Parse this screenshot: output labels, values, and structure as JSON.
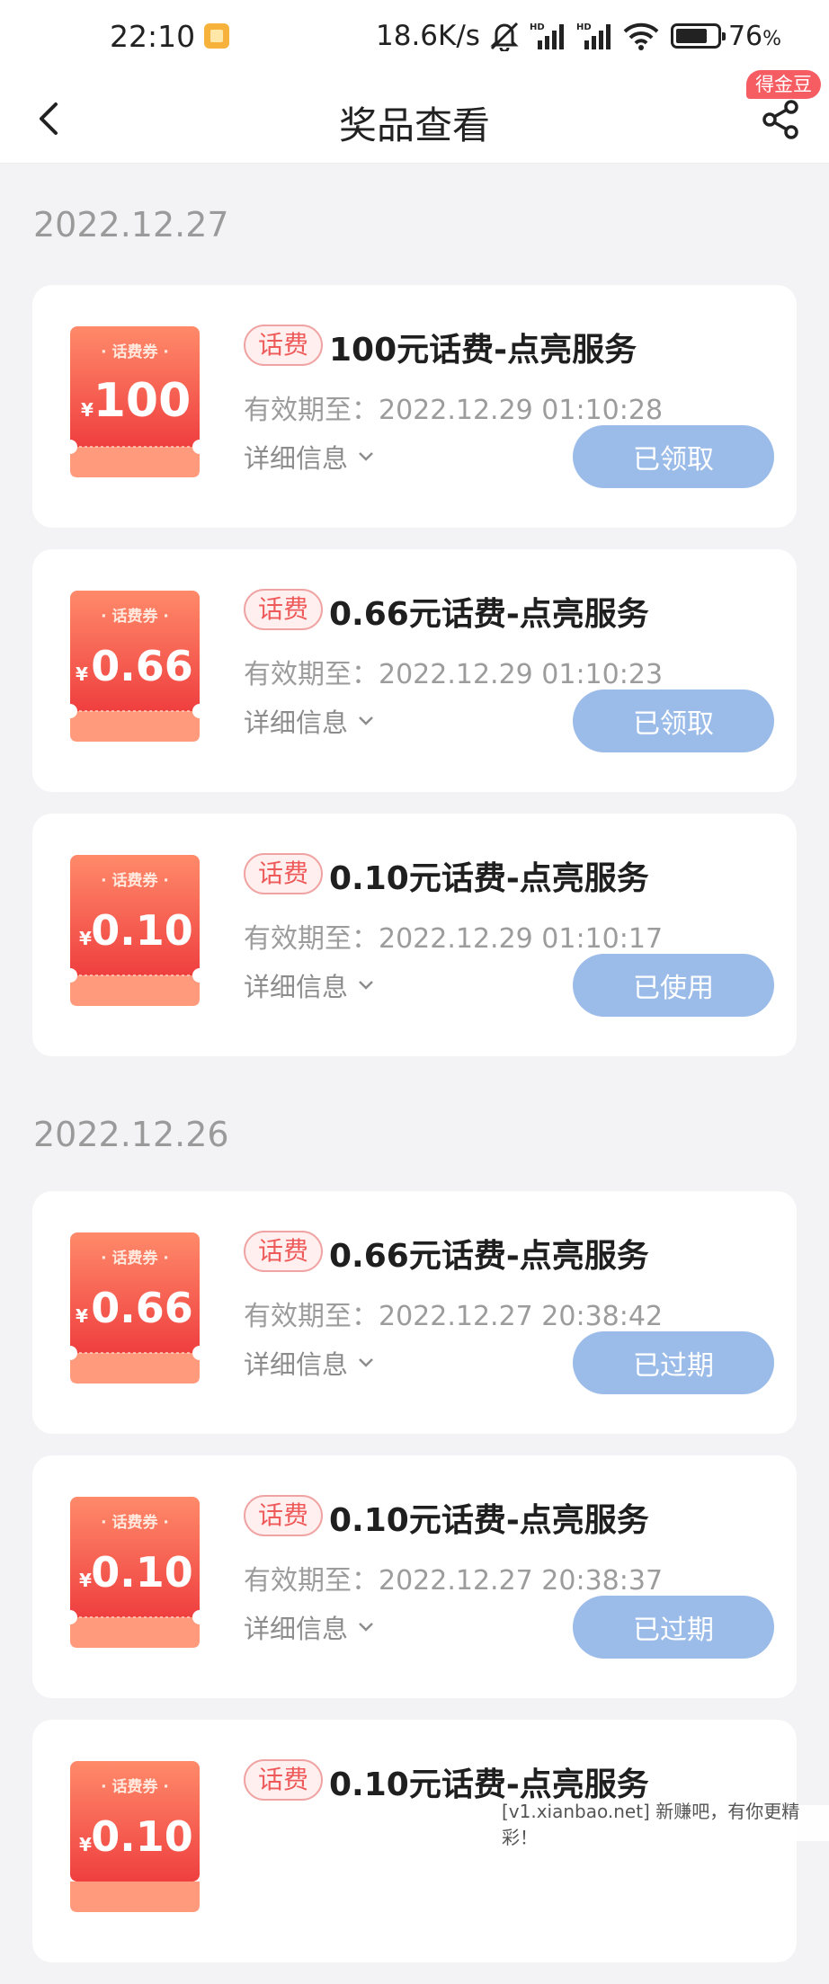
{
  "status_bar": {
    "time": "22:10",
    "net_speed": "18.6K/s",
    "battery_percent": "76",
    "battery_unit": "%"
  },
  "header": {
    "title": "奖品查看",
    "badge": "得金豆",
    "back_icon": "chevron-left-icon",
    "share_icon": "share-icon"
  },
  "groups": [
    {
      "date": "2022.12.27",
      "items": [
        {
          "coupon_label": "· 话费券 ·",
          "coupon_currency": "¥",
          "coupon_amount": "100",
          "tag": "话费",
          "title": "100元话费-点亮服务",
          "expiry_label": "有效期至：",
          "expiry": "2022.12.29 01:10:28",
          "details_label": "详细信息",
          "status": "已领取"
        },
        {
          "coupon_label": "· 话费券 ·",
          "coupon_currency": "¥",
          "coupon_amount": "0.66",
          "tag": "话费",
          "title": "0.66元话费-点亮服务",
          "expiry_label": "有效期至：",
          "expiry": "2022.12.29 01:10:23",
          "details_label": "详细信息",
          "status": "已领取"
        },
        {
          "coupon_label": "· 话费券 ·",
          "coupon_currency": "¥",
          "coupon_amount": "0.10",
          "tag": "话费",
          "title": "0.10元话费-点亮服务",
          "expiry_label": "有效期至：",
          "expiry": "2022.12.29 01:10:17",
          "details_label": "详细信息",
          "status": "已使用"
        }
      ]
    },
    {
      "date": "2022.12.26",
      "items": [
        {
          "coupon_label": "· 话费券 ·",
          "coupon_currency": "¥",
          "coupon_amount": "0.66",
          "tag": "话费",
          "title": "0.66元话费-点亮服务",
          "expiry_label": "有效期至：",
          "expiry": "2022.12.27 20:38:42",
          "details_label": "详细信息",
          "status": "已过期"
        },
        {
          "coupon_label": "· 话费券 ·",
          "coupon_currency": "¥",
          "coupon_amount": "0.10",
          "tag": "话费",
          "title": "0.10元话费-点亮服务",
          "expiry_label": "有效期至：",
          "expiry": "2022.12.27 20:38:37",
          "details_label": "详细信息",
          "status": "已过期"
        },
        {
          "coupon_label": "· 话费券 ·",
          "coupon_currency": "¥",
          "coupon_amount": "0.10",
          "tag": "话费",
          "title": "0.10元话费-点亮服务",
          "expiry_label": "有效期至：",
          "expiry": "",
          "details_label": "",
          "status": ""
        }
      ]
    }
  ],
  "watermark": "[v1.xianbao.net] 新赚吧，有你更精彩！",
  "colors": {
    "coupon_red": "#f4564f",
    "tag_red": "#ee5959",
    "status_blue": "#9bbce9",
    "badge_red": "#f55d62"
  }
}
